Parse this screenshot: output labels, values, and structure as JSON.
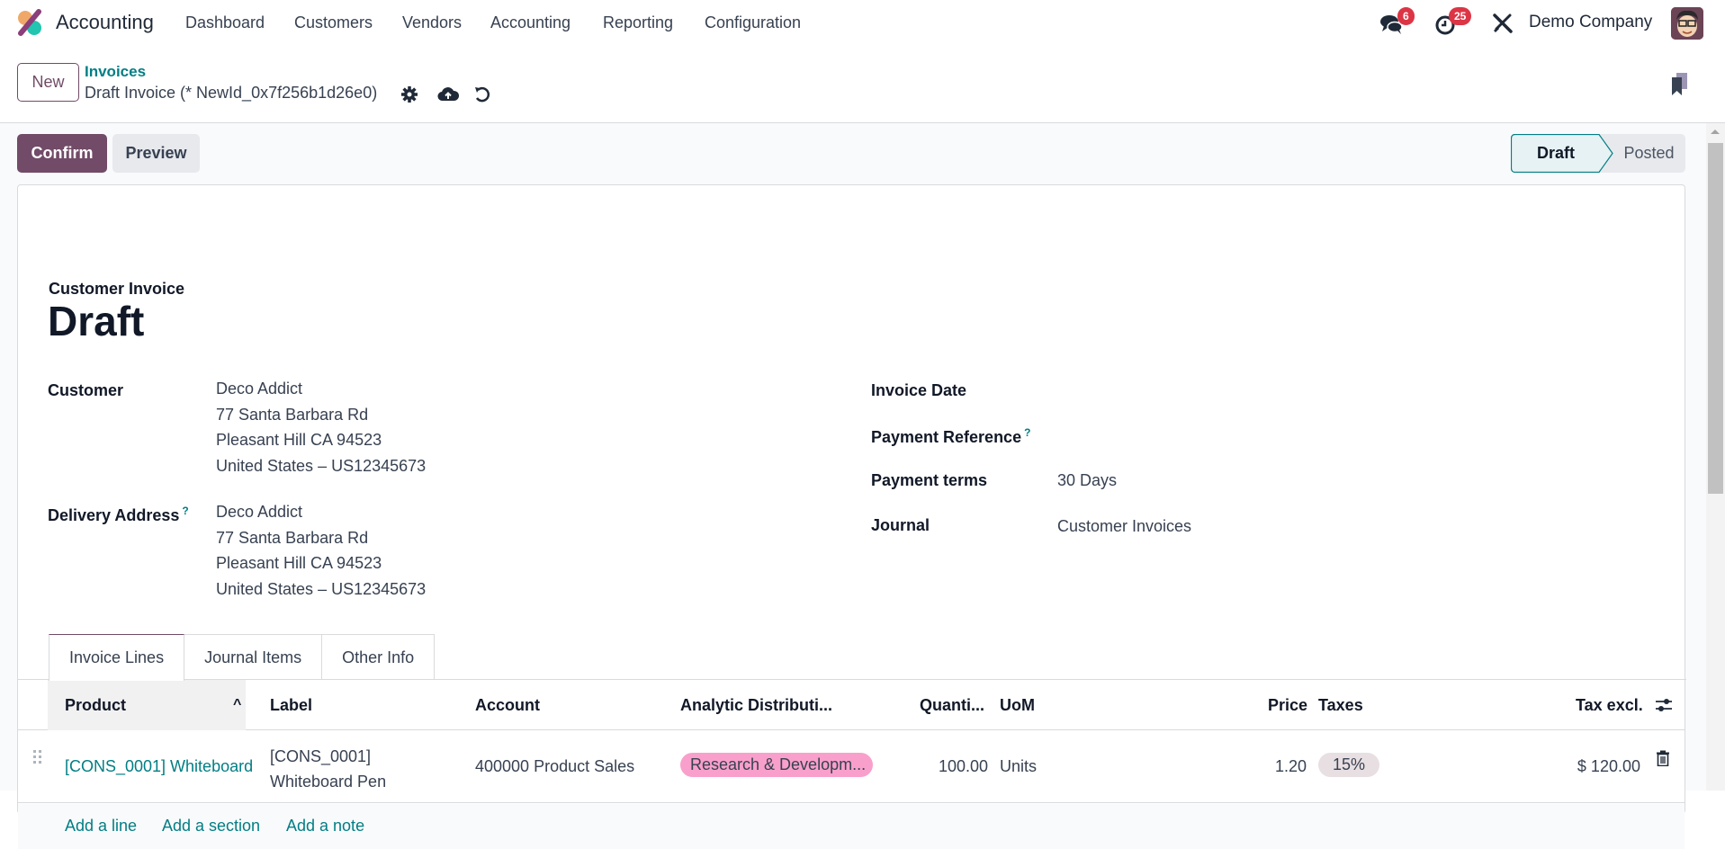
{
  "navbar": {
    "app_name": "Accounting",
    "menu": [
      "Dashboard",
      "Customers",
      "Vendors",
      "Accounting",
      "Reporting",
      "Configuration"
    ],
    "messages_count": "6",
    "activities_count": "25",
    "company": "Demo Company"
  },
  "control_panel": {
    "new_label": "New",
    "breadcrumb_parent": "Invoices",
    "record_title": "Draft Invoice (* NewId_0x7f256b1d26e0)"
  },
  "actions": {
    "confirm_label": "Confirm",
    "preview_label": "Preview"
  },
  "status": {
    "stages": [
      "Draft",
      "Posted"
    ],
    "current": "Draft"
  },
  "form": {
    "subtitle": "Customer Invoice",
    "title": "Draft",
    "customer_label": "Customer",
    "customer_lines": [
      "Deco Addict",
      "77 Santa Barbara Rd",
      "Pleasant Hill CA 94523",
      "United States – US12345673"
    ],
    "delivery_label": "Delivery Address",
    "delivery_lines": [
      "Deco Addict",
      "77 Santa Barbara Rd",
      "Pleasant Hill CA 94523",
      "United States – US12345673"
    ],
    "invoice_date_label": "Invoice Date",
    "invoice_date_value": "",
    "payment_ref_label": "Payment Reference",
    "payment_ref_value": "",
    "payment_terms_label": "Payment terms",
    "payment_terms_value": "30 Days",
    "journal_label": "Journal",
    "journal_value": "Customer Invoices",
    "help_mark": "?"
  },
  "tabs": [
    "Invoice Lines",
    "Journal Items",
    "Other Info"
  ],
  "table": {
    "columns": [
      "Product",
      "Label",
      "Account",
      "Analytic Distributi...",
      "Quanti...",
      "UoM",
      "Price",
      "Taxes",
      "Tax excl."
    ],
    "rows": [
      {
        "product": "[CONS_0001] Whiteboard",
        "label_line1": "[CONS_0001]",
        "label_line2": "Whiteboard Pen",
        "account": "400000 Product Sales",
        "analytic": "Research & Developm...",
        "quantity": "100.00",
        "uom": "Units",
        "price": "1.20",
        "taxes": "15%",
        "subtotal": "$ 120.00"
      }
    ],
    "add_line": "Add a line",
    "add_section": "Add a section",
    "add_note": "Add a note"
  },
  "colors": {
    "brand": "#714b67",
    "link": "#017e84",
    "badge": "#dc3545",
    "analytic_tag": "#f8a0cb",
    "tax_tag": "#e8dfe2"
  }
}
